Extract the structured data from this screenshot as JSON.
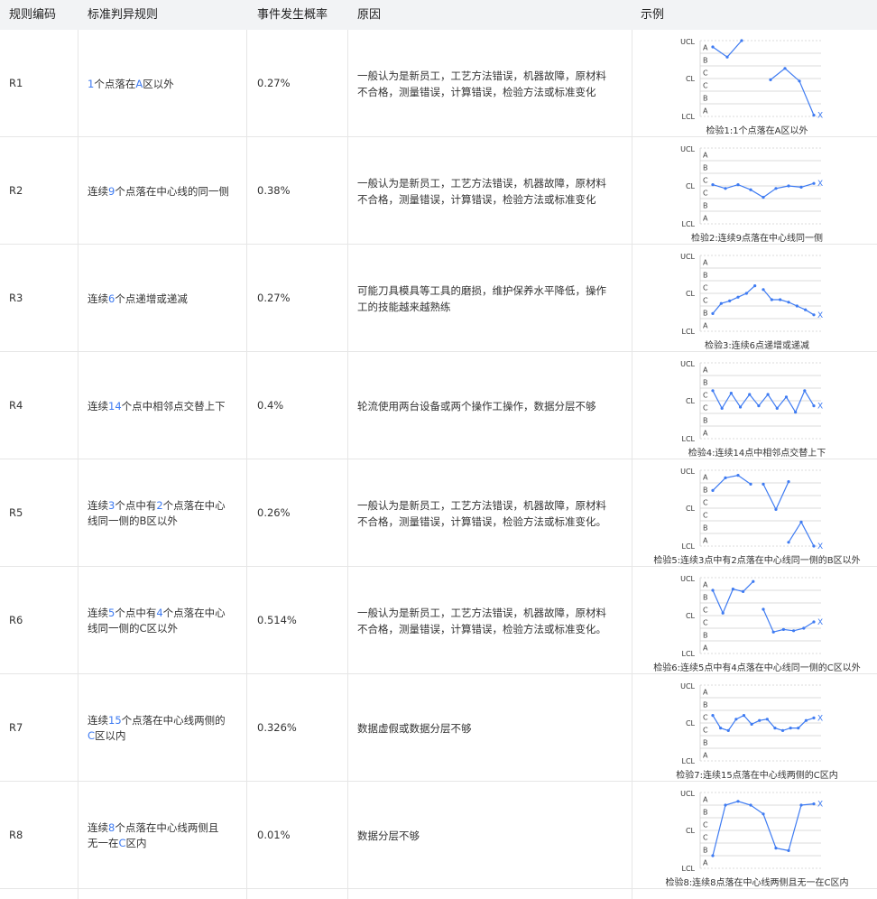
{
  "headers": [
    "规则编码",
    "标准判异规则",
    "事件发生概率",
    "原因",
    "示例"
  ],
  "zone_labels": {
    "ucl": "UCL",
    "cl": "CL",
    "lcl": "LCL",
    "zones": [
      "A",
      "B",
      "C",
      "C",
      "B",
      "A"
    ],
    "mark": "X"
  },
  "colors": {
    "line": "#3e7bf2",
    "grid": "#cfcfcf",
    "highlight": "#3e7bf2"
  },
  "rows": [
    {
      "code": "R1",
      "rule_parts": [
        {
          "t": "1",
          "hl": true
        },
        {
          "t": "个点落在",
          "hl": false
        },
        {
          "t": "A",
          "hl": true
        },
        {
          "t": "区以外",
          "hl": false
        }
      ],
      "rule_lines": 1,
      "prob": "0.27%",
      "reason": [
        "一般认为是新员工，工艺方法错误，机器故障，原材料",
        "不合格，测量错误，计算错误，检验方法或标准变化"
      ],
      "caption": "检验1:1个点落在A区以外"
    },
    {
      "code": "R2",
      "rule_parts": [
        {
          "t": "连续",
          "hl": false
        },
        {
          "t": "9",
          "hl": true
        },
        {
          "t": "个点落在中心线的同一侧",
          "hl": false
        }
      ],
      "rule_lines": 1,
      "prob": "0.38%",
      "reason": [
        "一般认为是新员工，工艺方法错误，机器故障，原材料",
        "不合格，测量错误，计算错误，检验方法或标准变化"
      ],
      "caption": "检验2:连续9点落在中心线同一侧"
    },
    {
      "code": "R3",
      "rule_parts": [
        {
          "t": "连续",
          "hl": false
        },
        {
          "t": "6",
          "hl": true
        },
        {
          "t": "个点递增或递减",
          "hl": false
        }
      ],
      "rule_lines": 1,
      "prob": "0.27%",
      "reason": [
        "可能刀具模具等工具的磨损，维护保养水平降低，操作",
        "工的技能越来越熟练"
      ],
      "caption": "检验3:连续6点递增或递减"
    },
    {
      "code": "R4",
      "rule_parts": [
        {
          "t": "连续",
          "hl": false
        },
        {
          "t": "14",
          "hl": true
        },
        {
          "t": "个点中相邻点交替上下",
          "hl": false
        }
      ],
      "rule_lines": 1,
      "prob": "0.4%",
      "reason": [
        "轮流使用两台设备或两个操作工操作，数据分层不够"
      ],
      "caption": "检验4:连续14点中相邻点交替上下"
    },
    {
      "code": "R5",
      "rule_parts": [
        {
          "t": "连续",
          "hl": false
        },
        {
          "t": "3",
          "hl": true
        },
        {
          "t": "个点中有",
          "hl": false
        },
        {
          "t": "2",
          "hl": true
        },
        {
          "t": "个点落在中心",
          "hl": false
        },
        {
          "br": true
        },
        {
          "t": "线同一侧的B区以外",
          "hl": false
        }
      ],
      "rule_lines": 2,
      "prob": "0.26%",
      "reason": [
        "一般认为是新员工，工艺方法错误，机器故障，原材料",
        "不合格，测量错误，计算错误，检验方法或标准变化。"
      ],
      "caption": "检验5:连续3点中有2点落在中心线同一侧的B区以外"
    },
    {
      "code": "R6",
      "rule_parts": [
        {
          "t": "连续",
          "hl": false
        },
        {
          "t": "5",
          "hl": true
        },
        {
          "t": "个点中有",
          "hl": false
        },
        {
          "t": "4",
          "hl": true
        },
        {
          "t": "个点落在中心",
          "hl": false
        },
        {
          "br": true
        },
        {
          "t": "线同一侧的C区以外",
          "hl": false
        }
      ],
      "rule_lines": 2,
      "prob": "0.514%",
      "reason": [
        "一般认为是新员工，工艺方法错误，机器故障，原材料",
        "不合格，测量错误，计算错误，检验方法或标准变化。"
      ],
      "caption": "检验6:连续5点中有4点落在中心线同一侧的C区以外"
    },
    {
      "code": "R7",
      "rule_parts": [
        {
          "t": "连续",
          "hl": false
        },
        {
          "t": "15",
          "hl": true
        },
        {
          "t": "个点落在中心线两侧的",
          "hl": false
        },
        {
          "br": true
        },
        {
          "t": "C",
          "hl": true
        },
        {
          "t": "区以内",
          "hl": false
        }
      ],
      "rule_lines": 2,
      "prob": "0.326%",
      "reason": [
        "数据虚假或数据分层不够"
      ],
      "caption": "检验7:连续15点落在中心线两侧的C区内"
    },
    {
      "code": "R8",
      "rule_parts": [
        {
          "t": "连续",
          "hl": false
        },
        {
          "t": "8",
          "hl": true
        },
        {
          "t": "个点落在中心线两侧且",
          "hl": false
        },
        {
          "br": true
        },
        {
          "t": "无一在",
          "hl": false
        },
        {
          "t": "C",
          "hl": true
        },
        {
          "t": "区内",
          "hl": false
        }
      ],
      "rule_lines": 2,
      "prob": "0.01%",
      "reason": [
        "数据分层不够"
      ],
      "caption": "检验8:连续8点落在中心线两侧且无一在C区内"
    }
  ],
  "series": [
    {
      "segments": [
        [
          5.5,
          4.7,
          6.3
        ],
        [
          2.9,
          3.8,
          2.8,
          0.1
        ]
      ],
      "x_start": [
        0,
        4
      ]
    },
    {
      "segments": [
        [
          3.1,
          2.8,
          3.1,
          2.7,
          2.1,
          2.8,
          3.0,
          2.9,
          3.2
        ]
      ],
      "x_start": [
        0
      ]
    },
    {
      "segments": [
        [
          1.4,
          2.2,
          2.4,
          2.7,
          3.0,
          3.6
        ],
        [
          3.3,
          2.5,
          2.5,
          2.3,
          2.0,
          1.7,
          1.3
        ]
      ],
      "x_start": [
        0,
        6
      ]
    },
    {
      "segments": [
        [
          3.8,
          2.4,
          3.6,
          2.5,
          3.5,
          2.6,
          3.5,
          2.4,
          3.3,
          2.1,
          3.8,
          2.6
        ]
      ],
      "x_start": [
        0
      ]
    },
    {
      "segments": [
        [
          4.4,
          5.4,
          5.6,
          4.9
        ],
        [
          4.9,
          2.9,
          5.1
        ],
        [
          0.3,
          1.9,
          0.0
        ]
      ],
      "x_start": [
        0,
        4,
        6
      ]
    },
    {
      "segments": [
        [
          5.0,
          3.2,
          5.1,
          4.9,
          5.7
        ],
        [
          3.5,
          1.7,
          1.9,
          1.8,
          2.0,
          2.5
        ]
      ],
      "x_start": [
        0,
        5
      ]
    },
    {
      "segments": [
        [
          3.6,
          2.6,
          2.4,
          3.3,
          3.6,
          2.9,
          3.2,
          3.3,
          2.6,
          2.4,
          2.6,
          2.6,
          3.2,
          3.4
        ]
      ],
      "x_start": [
        0
      ]
    },
    {
      "segments": [
        [
          1.0,
          5.0,
          5.3,
          5.0,
          4.3,
          1.6,
          1.4,
          5.0,
          5.1
        ]
      ],
      "x_start": [
        0
      ]
    }
  ]
}
